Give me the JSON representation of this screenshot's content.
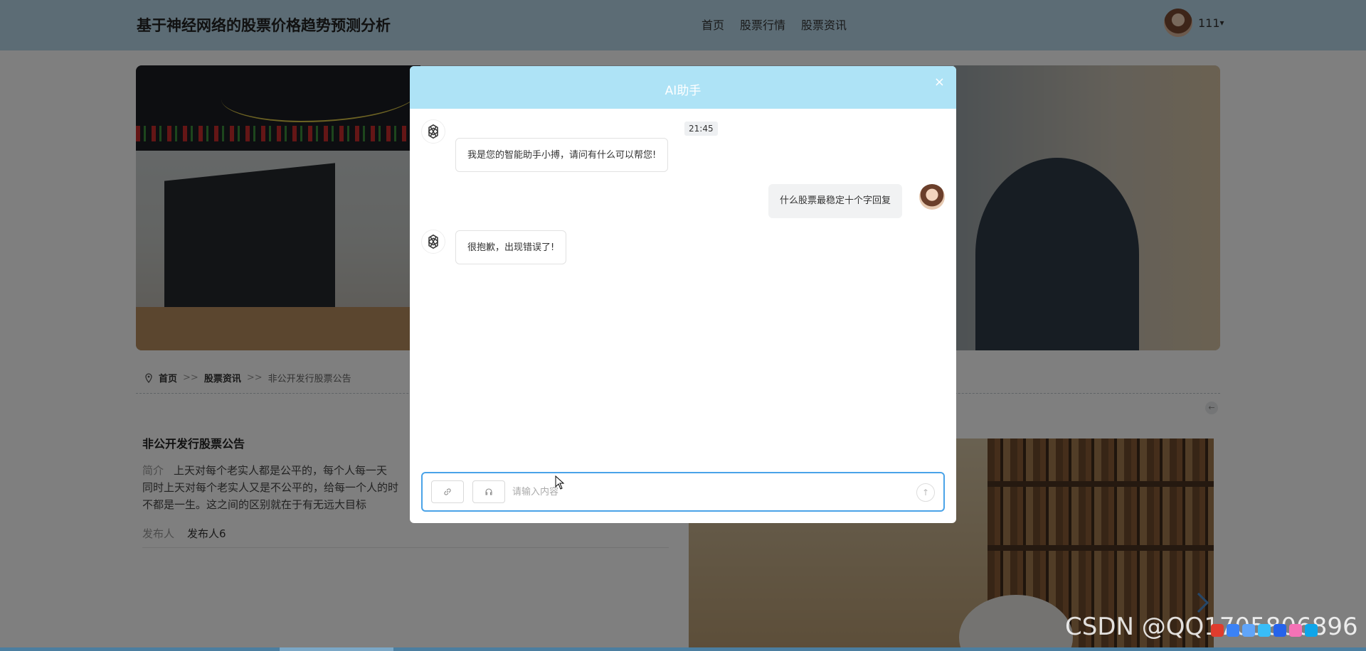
{
  "site": {
    "title": "基于神经网络的股票价格趋势预测分析"
  },
  "nav": {
    "items": [
      "首页",
      "股票行情",
      "股票资讯"
    ]
  },
  "user": {
    "name": "111",
    "caret": "▾"
  },
  "breadcrumb": {
    "home": "首页",
    "separator": ">>",
    "section": "股票资讯",
    "current": "非公开发行股票公告"
  },
  "article": {
    "title": "非公开发行股票公告",
    "summary_label": "简介",
    "summary_lines": [
      "上天对每个老实人都是公平的，每个人每一天",
      "同时上天对每个老实人又是不公平的，给每一个人的时",
      "不都是一生。这之间的区别就在于有无远大目标"
    ],
    "publisher_label": "发布人",
    "publisher": "发布人6"
  },
  "chat": {
    "title": "AI助手",
    "close": "×",
    "timestamp": "21:45",
    "messages": [
      {
        "role": "bot",
        "text": "我是您的智能助手小搏，请问有什么可以帮您!"
      },
      {
        "role": "user",
        "text": "什么股票最稳定十个字回复"
      },
      {
        "role": "bot",
        "text": "很抱歉，出现错误了!"
      }
    ],
    "input_placeholder": "请输入内容",
    "icons": {
      "attach": "link-icon",
      "voice": "headset-icon",
      "send": "arrow-up-icon",
      "bot": "openai-logo-icon"
    }
  },
  "watermark": "CSDN @QQ1705806896",
  "colors": {
    "header": "#b8d9ea",
    "dialog_header": "#aee3f6",
    "input_border": "#4aa3e8"
  }
}
